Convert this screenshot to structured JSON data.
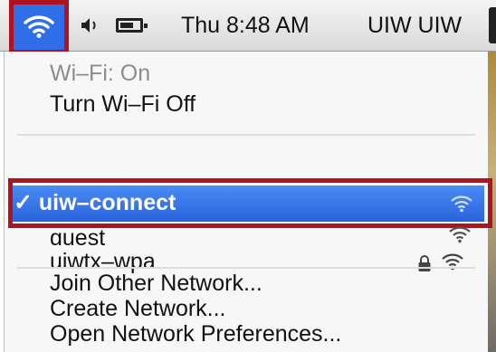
{
  "menubar": {
    "clock": "Thu 8:48 AM",
    "user": "UIW UIW",
    "icons": [
      "wifi-icon",
      "volume-icon",
      "battery-icon"
    ],
    "accent_color": "#2f6ee8",
    "highlight_border_color": "#b0131d"
  },
  "wifi_menu": {
    "status": "Wi–Fi: On",
    "toggle": "Turn Wi–Fi Off",
    "networks": [
      {
        "name": "uiw–connect",
        "selected": true,
        "checkmark": "✓",
        "locked": false
      },
      {
        "name": "guest",
        "selected": false,
        "locked": false
      },
      {
        "name": "uiwtx–wpa",
        "selected": false,
        "locked": true
      }
    ],
    "actions": {
      "join_other": "Join Other Network...",
      "create": "Create Network...",
      "preferences": "Open Network Preferences..."
    }
  }
}
